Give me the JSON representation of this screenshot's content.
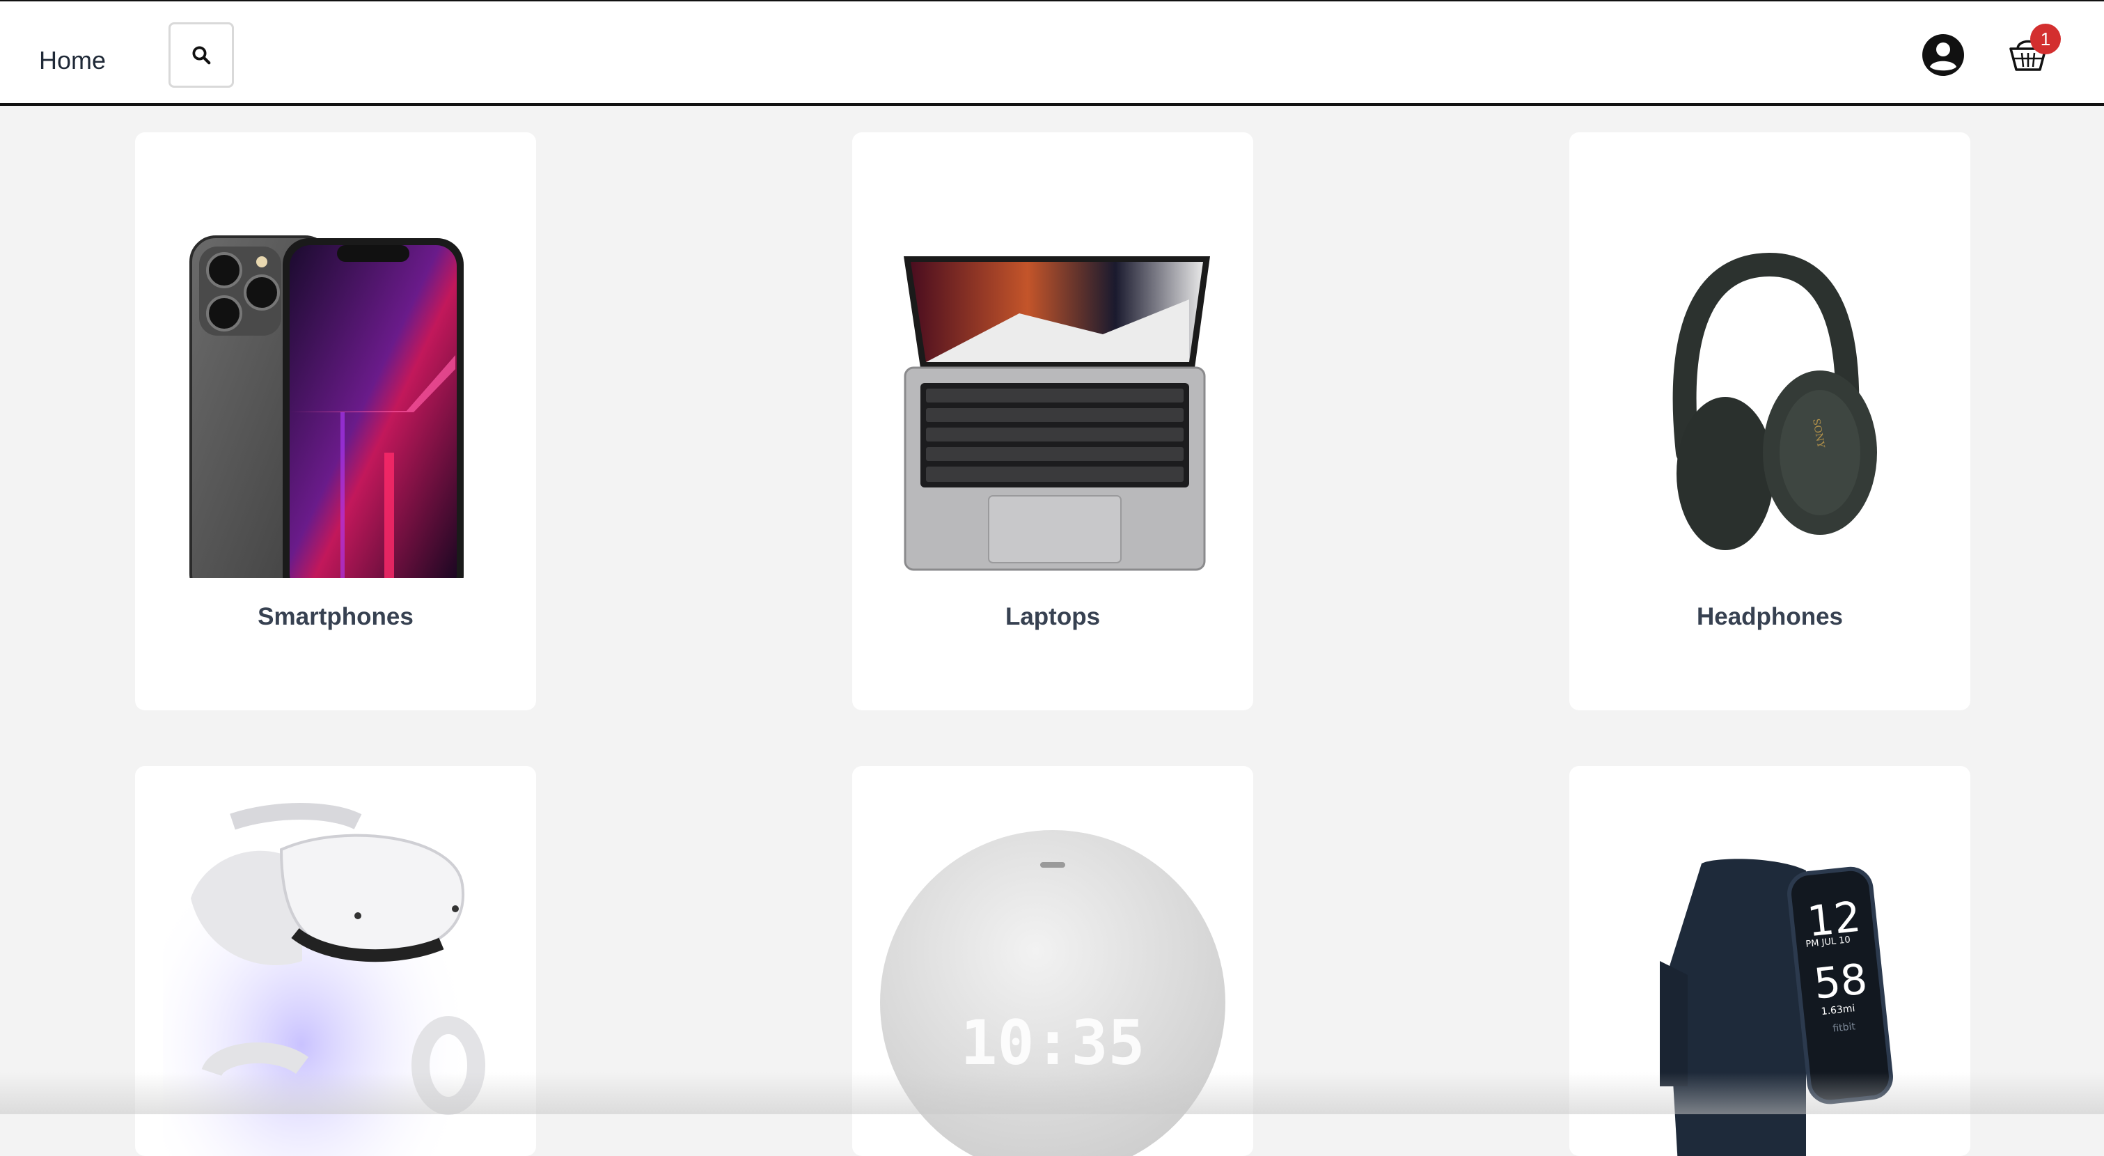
{
  "nav": {
    "home_label": "Home",
    "cart_count": "1",
    "icons": {
      "search": "search-icon",
      "account": "user-circle-icon",
      "cart": "basket-icon"
    }
  },
  "categories": [
    {
      "label": "Smartphones",
      "image": "smartphone-image"
    },
    {
      "label": "Laptops",
      "image": "laptop-image"
    },
    {
      "label": "Headphones",
      "image": "headphones-image"
    },
    {
      "label": "",
      "image": "vr-headset-image"
    },
    {
      "label": "",
      "image": "smart-speaker-image"
    },
    {
      "label": "",
      "image": "fitness-tracker-image"
    }
  ],
  "images": {
    "speaker_clock": "10:35",
    "tracker_time_hour": "12",
    "tracker_time_min": "58",
    "tracker_date": "PM JUL 10",
    "tracker_distance": "1.63mi",
    "tracker_brand": "fitbit",
    "headphones_brand": "SONY"
  },
  "colors": {
    "badge": "#d32f2f",
    "background": "#f3f3f3",
    "card": "#ffffff",
    "label": "#374151"
  }
}
